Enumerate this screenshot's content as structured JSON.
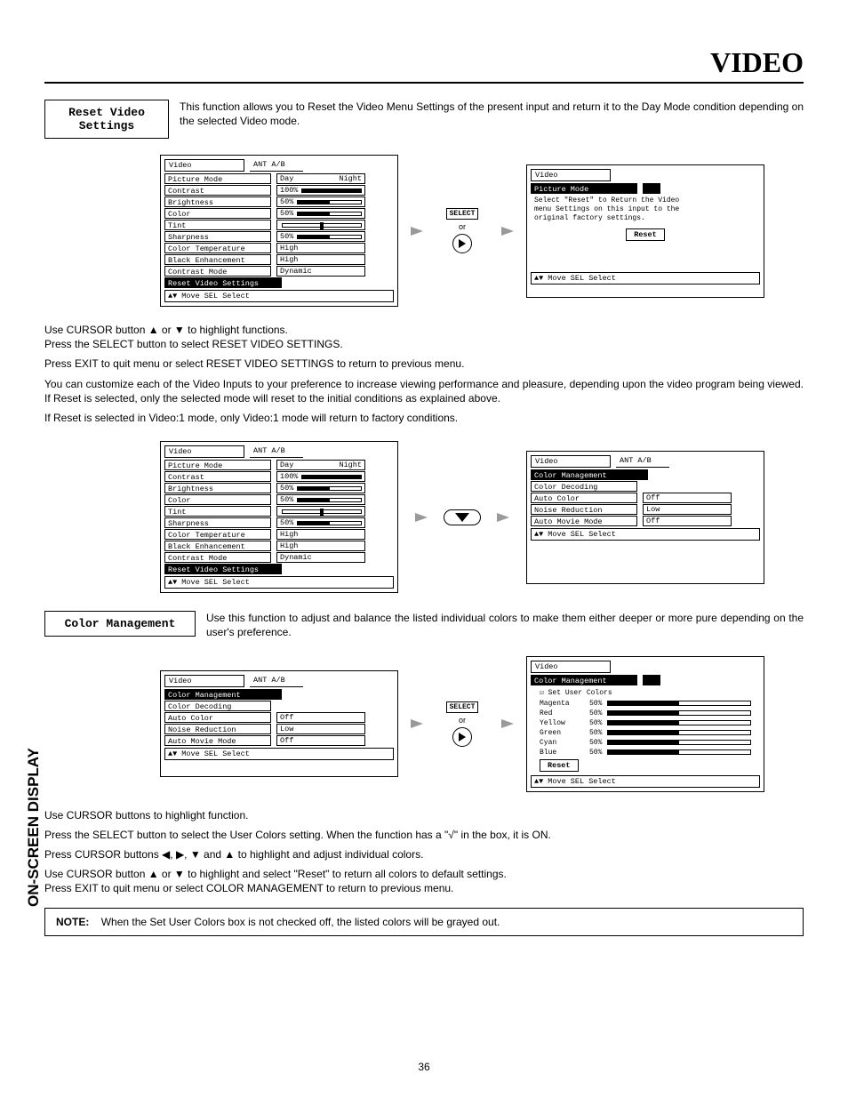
{
  "page_title": "VIDEO",
  "sidebar_label": "ON-SCREEN DISPLAY",
  "reset_video": {
    "heading_l1": "Reset Video",
    "heading_l2": "Settings",
    "desc": "This function allows you to Reset the Video Menu Settings of the present input and return it to the Day Mode condition depending on the selected Video mode."
  },
  "osd_video_left": {
    "title": "Video",
    "ant": "ANT A/B",
    "items": [
      {
        "label": "Picture Mode",
        "val": "Day",
        "val2": "Night"
      },
      {
        "label": "Contrast",
        "pct": "100%",
        "fill": 100
      },
      {
        "label": "Brightness",
        "pct": "50%",
        "fill": 50
      },
      {
        "label": "Color",
        "pct": "50%",
        "fill": 50
      },
      {
        "label": "Tint",
        "pct": "",
        "fill": 50,
        "center": true
      },
      {
        "label": "Sharpness",
        "pct": "50%",
        "fill": 50
      },
      {
        "label": "Color Temperature",
        "val": "High"
      },
      {
        "label": "Black Enhancement",
        "val": "High"
      },
      {
        "label": "Contrast Mode",
        "val": "Dynamic"
      },
      {
        "label": "Reset Video Settings",
        "hi": true,
        "arrows": true
      }
    ],
    "foot": "▲▼ Move  SEL Select"
  },
  "select_label": "SELECT",
  "or_label": "or",
  "osd_reset_right": {
    "title": "Video",
    "row1_label": "Picture Mode",
    "msg_l1": "Select \"Reset\" to Return the Video",
    "msg_l2": "menu Settings on this input to the",
    "msg_l3": "original factory settings.",
    "reset_btn": "Reset",
    "foot": "▲▼ Move         SEL Select"
  },
  "para1_l1": "Use CURSOR button ▲ or ▼ to highlight functions.",
  "para1_l2": "Press the SELECT button to select RESET VIDEO SETTINGS.",
  "para2": "Press EXIT to quit menu or select RESET VIDEO SETTINGS to return to previous menu.",
  "para3": "You can customize each of the Video Inputs to your preference to increase viewing performance and pleasure, depending upon the video program being viewed. If Reset is selected, only the selected mode will reset to the initial conditions as explained above.",
  "para4": "If Reset is selected in Video:1 mode, only Video:1 mode will return to factory conditions.",
  "osd_color_mgmt": {
    "title": "Video",
    "ant": "ANT A/B",
    "items": [
      {
        "label": "Color Management",
        "hi": true,
        "arrows": true
      },
      {
        "label": "Color Decoding"
      },
      {
        "label": "Auto Color",
        "val": "Off"
      },
      {
        "label": "Noise Reduction",
        "val": "Low"
      },
      {
        "label": "Auto Movie Mode",
        "val": "Off"
      }
    ],
    "foot": "▲▼ Move  SEL Select"
  },
  "color_mgmt_section": {
    "heading": "Color Management",
    "desc": "Use this function to adjust and balance the listed individual colors to make them either deeper or more pure depending on the user's preference."
  },
  "osd_color_detail": {
    "title": "Video",
    "row1": "Color Management",
    "checkbox": "☑ Set User Colors",
    "colors": [
      {
        "name": "Magenta",
        "pct": "50%"
      },
      {
        "name": "Red",
        "pct": "50%"
      },
      {
        "name": "Yellow",
        "pct": "50%"
      },
      {
        "name": "Green",
        "pct": "50%"
      },
      {
        "name": "Cyan",
        "pct": "50%"
      },
      {
        "name": "Blue",
        "pct": "50%"
      }
    ],
    "reset": "Reset",
    "foot": "▲▼ Move         SEL Select"
  },
  "bottom_para1": "Use CURSOR buttons to highlight function.",
  "bottom_para2": "Press the SELECT button to select the User Colors setting.  When the function has a \"√\" in the box, it is ON.",
  "bottom_para3": "Press CURSOR buttons ◀, ▶, ▼ and ▲ to highlight and adjust individual colors.",
  "bottom_para4": "Use CURSOR button ▲ or ▼ to highlight and select \"Reset\" to return all colors to default settings.",
  "bottom_para5": "Press EXIT to quit menu or select COLOR MANAGEMENT to return to previous menu.",
  "note_label": "NOTE:",
  "note_text": "When the Set User Colors box is not checked off, the listed colors will be grayed out.",
  "page_num": "36"
}
